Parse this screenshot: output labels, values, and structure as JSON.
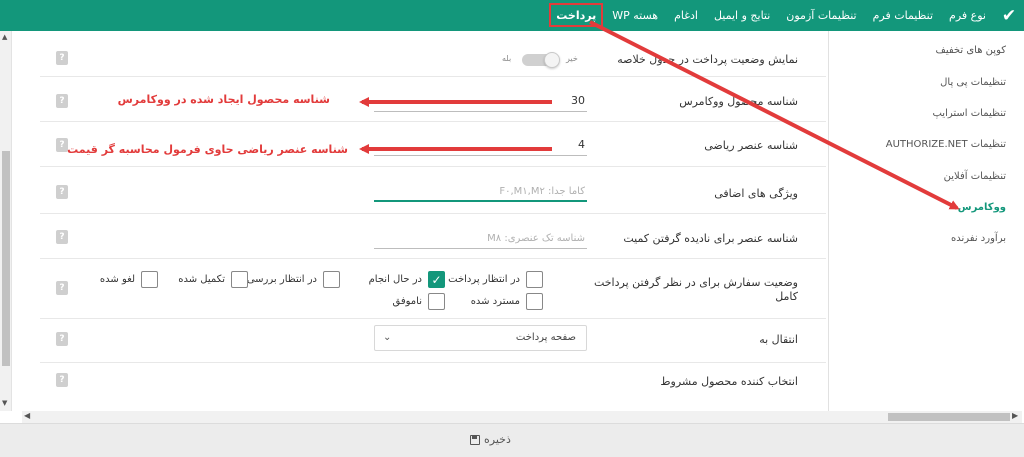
{
  "topbar": {
    "tabs": [
      {
        "label": "نوع فرم"
      },
      {
        "label": "تنظیمات فرم"
      },
      {
        "label": "تنظیمات آزمون"
      },
      {
        "label": "نتایج و ایمیل"
      },
      {
        "label": "ادغام"
      },
      {
        "label": "هسته WP"
      },
      {
        "label": "پرداخت"
      }
    ]
  },
  "sidebar": {
    "items": [
      {
        "label": "کوپن های تخفیف"
      },
      {
        "label": "تنظیمات پی پال"
      },
      {
        "label": "تنظیمات استرایپ"
      },
      {
        "label": "تنظیمات AUTHORIZE.NET"
      },
      {
        "label": "تنظیمات آفلاین"
      },
      {
        "label": "ووکامرس"
      },
      {
        "label": "برآورد نفرنده"
      }
    ]
  },
  "settings": {
    "show_payment": {
      "label": "نمایش وضعیت پرداخت در جدول خلاصه",
      "toggle_no": "خیر",
      "toggle_yes": "بله"
    },
    "product_id": {
      "label": "شناسه محصول ووکامرس",
      "value": "30"
    },
    "math_id": {
      "label": "شناسه عنصر ریاضی",
      "value": "4"
    },
    "extra_attrs": {
      "label": "ویژگی های اضافی",
      "placeholder": "کاما جدا: F۰,M۱,M۲"
    },
    "ignore_qty": {
      "label": "شناسه عنصر برای نادیده گرفتن کمیت",
      "placeholder": "شناسه تک عنصری: M۸"
    },
    "order_status": {
      "label_line1": "وضعیت سفارش برای در نظر گرفتن پرداخت",
      "label_line2": "کامل",
      "options": [
        {
          "label": "در انتظار پرداخت",
          "checked": false
        },
        {
          "label": "در حال انجام",
          "checked": true
        },
        {
          "label": "در انتظار بررسی",
          "checked": false
        },
        {
          "label": "تکمیل شده",
          "checked": false
        },
        {
          "label": "لغو شده",
          "checked": false
        },
        {
          "label": "مسترد شده",
          "checked": false
        },
        {
          "label": "ناموفق",
          "checked": false
        }
      ]
    },
    "redirect": {
      "label": "انتقال به",
      "value": "صفحه پرداخت"
    },
    "conditional": {
      "label": "انتخاب کننده محصول مشروط"
    }
  },
  "annotations": {
    "product_note": "شناسه محصول ایجاد شده در ووکامرس",
    "math_note": "شناسه عنصر ریاضی حاوی فرمول محاسبه گر قیمت"
  },
  "footer": {
    "save_label": "ذخیره"
  },
  "colors": {
    "accent": "#13977b",
    "annotation": "#e23b3b"
  }
}
